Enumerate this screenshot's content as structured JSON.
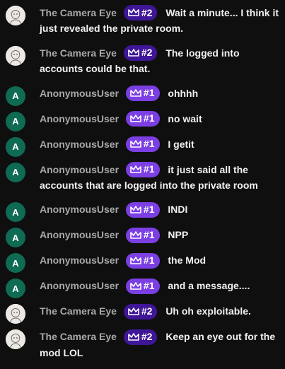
{
  "colors": {
    "background": "#0f0f0f",
    "author": "#a8a8a8",
    "badge_rank2": "#3f1697",
    "badge_rank1": "#7b3fe4",
    "avatar_letter_bg": "#0f6b53"
  },
  "messages": [
    {
      "author": "The Camera Eye",
      "avatar": "camera",
      "badge": "#2",
      "text": "Wait a minute... I think it just revealed the private room."
    },
    {
      "author": "The Camera Eye",
      "avatar": "camera",
      "badge": "#2",
      "text": "The logged into accounts could be that."
    },
    {
      "author": "AnonymousUser",
      "avatar": "A",
      "badge": "#1",
      "text": "ohhhh"
    },
    {
      "author": "AnonymousUser",
      "avatar": "A",
      "badge": "#1",
      "text": "no wait"
    },
    {
      "author": "AnonymousUser",
      "avatar": "A",
      "badge": "#1",
      "text": "I getit"
    },
    {
      "author": "AnonymousUser",
      "avatar": "A",
      "badge": "#1",
      "text": "it just said all the accounts that are logged into the private room"
    },
    {
      "author": "AnonymousUser",
      "avatar": "A",
      "badge": "#1",
      "text": "INDI"
    },
    {
      "author": "AnonymousUser",
      "avatar": "A",
      "badge": "#1",
      "text": "NPP"
    },
    {
      "author": "AnonymousUser",
      "avatar": "A",
      "badge": "#1",
      "text": "the Mod"
    },
    {
      "author": "AnonymousUser",
      "avatar": "A",
      "badge": "#1",
      "text": "and a message...."
    },
    {
      "author": "The Camera Eye",
      "avatar": "camera",
      "badge": "#2",
      "text": "Uh oh exploitable."
    },
    {
      "author": "The Camera Eye",
      "avatar": "camera",
      "badge": "#2",
      "text": "Keep an eye out for the mod LOL"
    }
  ]
}
